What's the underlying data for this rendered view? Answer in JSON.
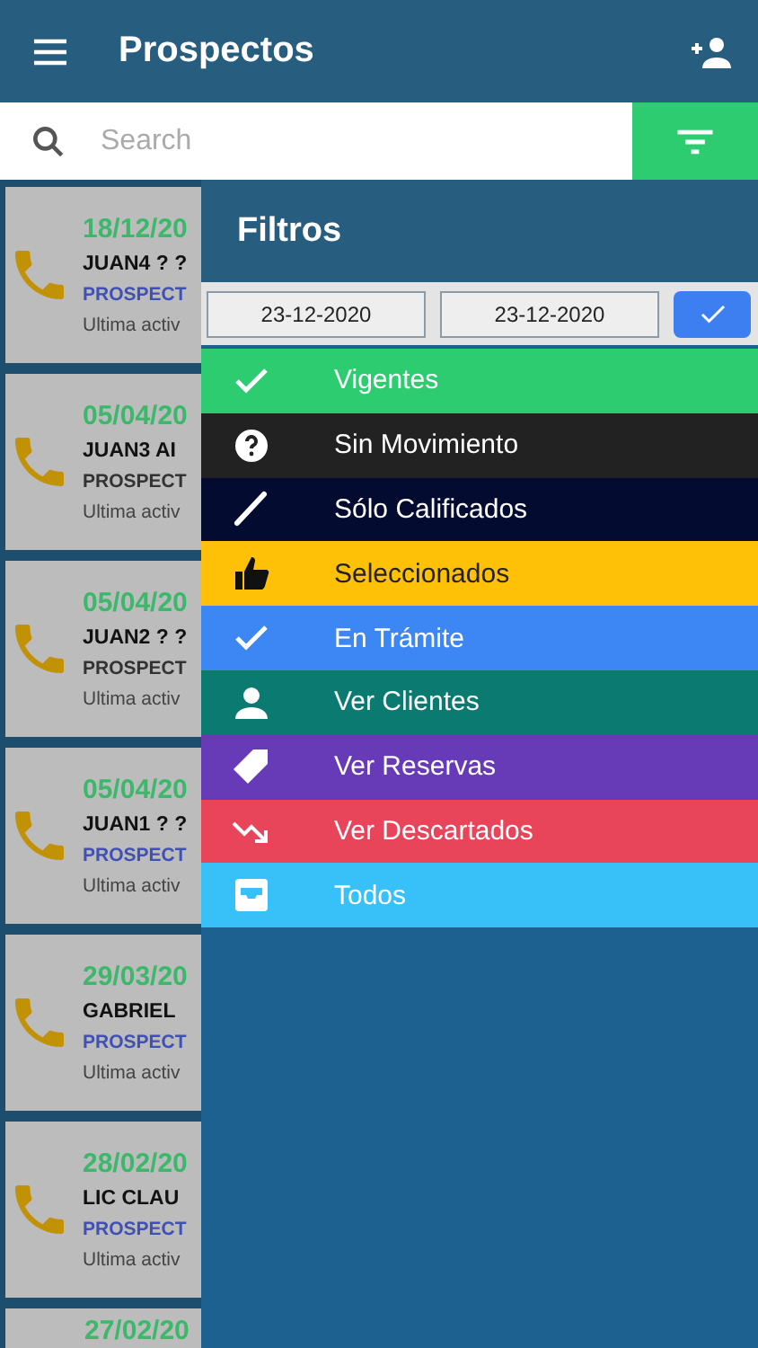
{
  "header": {
    "title": "Prospectos"
  },
  "search": {
    "placeholder": "Search"
  },
  "cards": [
    {
      "date": "18/12/20",
      "name": "JUAN4 ? ?",
      "status": "PROSPECT",
      "color": "#3f51b5",
      "activity": "Ultima activ"
    },
    {
      "date": "05/04/20",
      "name": "JUAN3 AI",
      "status": "PROSPECT",
      "color": "#333333",
      "activity": "Ultima activ"
    },
    {
      "date": "05/04/20",
      "name": "JUAN2 ? ?",
      "status": "PROSPECT",
      "color": "#333333",
      "activity": "Ultima activ"
    },
    {
      "date": "05/04/20",
      "name": "JUAN1 ? ?",
      "status": "PROSPECT",
      "color": "#3f51b5",
      "activity": "Ultima activ"
    },
    {
      "date": "29/03/20",
      "name": "GABRIEL",
      "status": "PROSPECT",
      "color": "#3f51b5",
      "activity": "Ultima activ"
    },
    {
      "date": "28/02/20",
      "name": "LIC CLAU",
      "status": "PROSPECT",
      "color": "#3f51b5",
      "activity": "Ultima activ"
    },
    {
      "date": "27/02/20"
    }
  ],
  "filters": {
    "title": "Filtros",
    "date_from": "23-12-2020",
    "date_to": "23-12-2020",
    "items": [
      {
        "label": "Vigentes",
        "kind": "check",
        "color": "#2ecc71"
      },
      {
        "label": "Sin Movimiento",
        "kind": "question",
        "color": "#222222"
      },
      {
        "label": "Sólo Calificados",
        "kind": "pencil",
        "color": "#030c30"
      },
      {
        "label": "Seleccionados",
        "kind": "thumb",
        "color": "#ffc107"
      },
      {
        "label": "En Trámite",
        "kind": "check",
        "color": "#3d87f5"
      },
      {
        "label": "Ver Clientes",
        "kind": "person",
        "color": "#0b7a70"
      },
      {
        "label": "Ver Reservas",
        "kind": "tag",
        "color": "#673ab7"
      },
      {
        "label": "Ver Descartados",
        "kind": "trend",
        "color": "#e8445a"
      },
      {
        "label": "Todos",
        "kind": "inbox",
        "color": "#38c0f8"
      }
    ]
  }
}
